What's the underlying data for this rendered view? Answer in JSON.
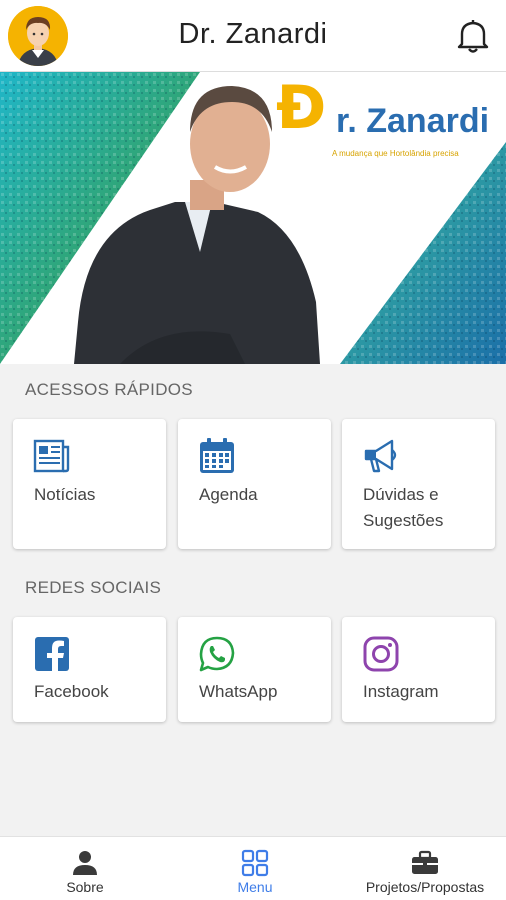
{
  "header": {
    "title": "Dr. Zanardi"
  },
  "banner": {
    "logo_mark": "Đ",
    "logo_text": "r. Zanardi",
    "slogan": "A mudança que Hortolândia precisa"
  },
  "quick_access": {
    "title": "ACESSOS RÁPIDOS",
    "items": [
      {
        "label": "Notícias",
        "icon": "newspaper-icon"
      },
      {
        "label": "Agenda",
        "icon": "calendar-icon"
      },
      {
        "label": "Dúvidas e Sugestões",
        "icon": "megaphone-icon"
      }
    ]
  },
  "social": {
    "title": "REDES SOCIAIS",
    "items": [
      {
        "label": "Facebook",
        "icon": "facebook-icon"
      },
      {
        "label": "WhatsApp",
        "icon": "whatsapp-icon"
      },
      {
        "label": "Instagram",
        "icon": "instagram-icon"
      }
    ]
  },
  "bottom_nav": {
    "items": [
      {
        "label": "Sobre",
        "icon": "person-icon"
      },
      {
        "label": "Menu",
        "icon": "grid-icon",
        "active": true
      },
      {
        "label": "Projetos/Propostas",
        "icon": "briefcase-icon"
      }
    ]
  },
  "colors": {
    "accent": "#3f7de8",
    "icon_blue": "#2a6db0",
    "whatsapp_green": "#25a244",
    "instagram_purple": "#8e44ad",
    "logo_yellow": "#f5b301"
  }
}
